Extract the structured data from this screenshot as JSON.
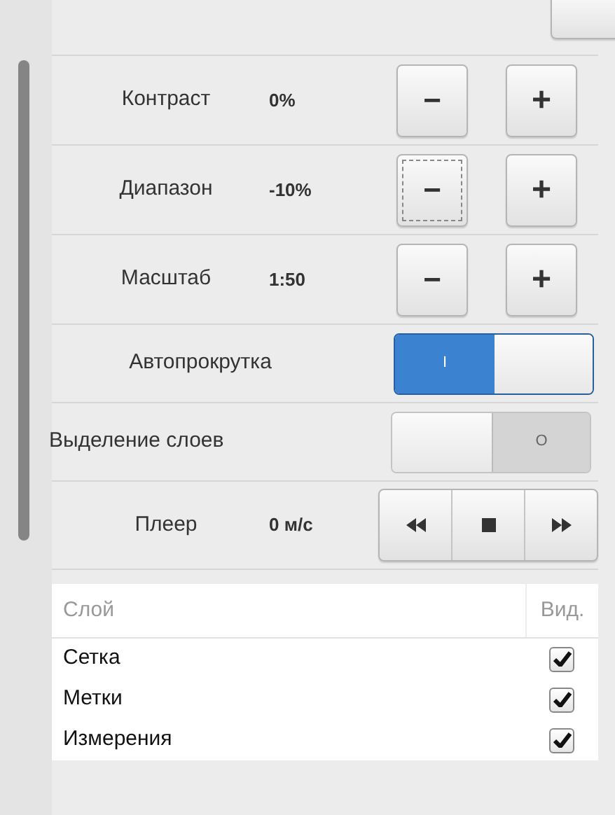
{
  "steppers": [
    {
      "label": "Контраст",
      "value": "0%",
      "minus": "−",
      "plus": "+",
      "focused": false
    },
    {
      "label": "Диапазон",
      "value": "-10%",
      "minus": "−",
      "plus": "+",
      "focused": true
    },
    {
      "label": "Масштаб",
      "value": "1:50",
      "minus": "−",
      "plus": "+",
      "focused": false
    }
  ],
  "toggles": [
    {
      "label": "Автопрокрутка",
      "on": true,
      "mark": "I"
    },
    {
      "label": "Выделение слоев",
      "on": false,
      "mark": "O"
    }
  ],
  "player": {
    "label": "Плеер",
    "speed": "0 м/с"
  },
  "table": {
    "columns": [
      "Слой",
      "Вид."
    ],
    "rows": [
      {
        "name": "Сетка",
        "checked": true
      },
      {
        "name": "Метки",
        "checked": true
      },
      {
        "name": "Измерения",
        "checked": true
      }
    ]
  }
}
